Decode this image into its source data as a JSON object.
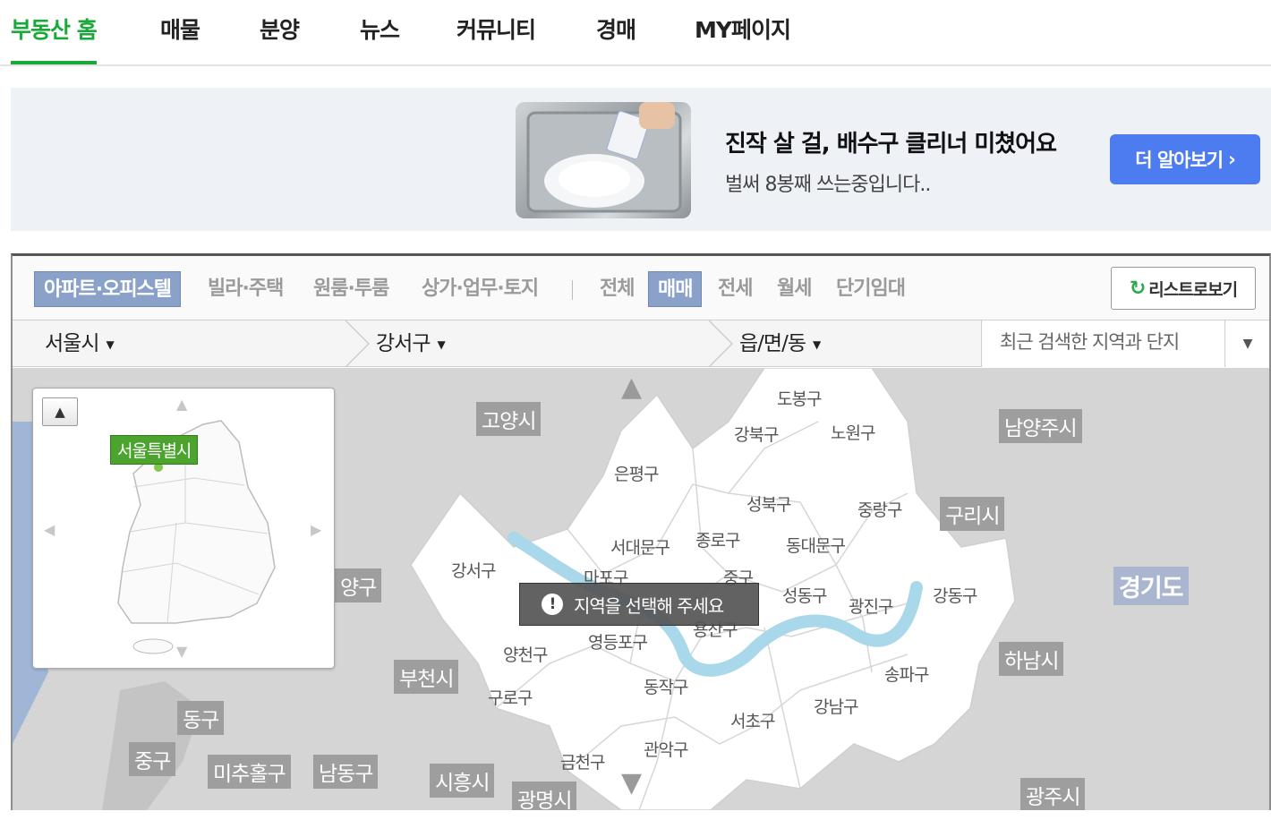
{
  "nav": {
    "tabs": [
      {
        "label": "부동산 홈"
      },
      {
        "label": "매물"
      },
      {
        "label": "분양"
      },
      {
        "label": "뉴스"
      },
      {
        "label": "커뮤니티"
      },
      {
        "label": "경매"
      },
      {
        "label": "MY페이지"
      }
    ]
  },
  "banner": {
    "title": "진작 살 걸, 배수구 클리너 미쳤어요",
    "subtitle": "벌써 8봉째 쓰는중입니다..",
    "cta": "더 알아보기",
    "cta_icon": "chevron-right-icon"
  },
  "filters": {
    "property_types": [
      "아파트·오피스텔",
      "빌라·주택",
      "원룸·투룸",
      "상가·업무·토지"
    ],
    "deal_types": [
      "전체",
      "매매",
      "전세",
      "월세",
      "단기임대"
    ],
    "selected_property": "아파트·오피스텔",
    "selected_deal": "매매",
    "list_button": "리스트로보기",
    "list_icon": "refresh-icon"
  },
  "region": {
    "city": "서울시",
    "district": "강서구",
    "dong": "읍/면/동",
    "recent": "최근 검색한 지역과 단지"
  },
  "map": {
    "notice": "지역을 선택해 주세요",
    "minimap_label": "서울특별시",
    "districts": [
      "도봉구",
      "강북구",
      "노원구",
      "은평구",
      "성북구",
      "중랑구",
      "서대문구",
      "종로구",
      "동대문구",
      "강서구",
      "마포구",
      "중구",
      "성동구",
      "광진구",
      "강동구",
      "용산구",
      "양천구",
      "영등포구",
      "동작구",
      "구로구",
      "송파구",
      "강남구",
      "서초구",
      "관악구",
      "금천구"
    ],
    "outer_regions": [
      "고양시",
      "남양주시",
      "구리시",
      "경기도",
      "하남시",
      "부천시",
      "양구",
      "동구",
      "중구",
      "미추홀구",
      "남동구",
      "시흥시",
      "광명시",
      "광주시"
    ],
    "accent": "#1aa83a"
  }
}
